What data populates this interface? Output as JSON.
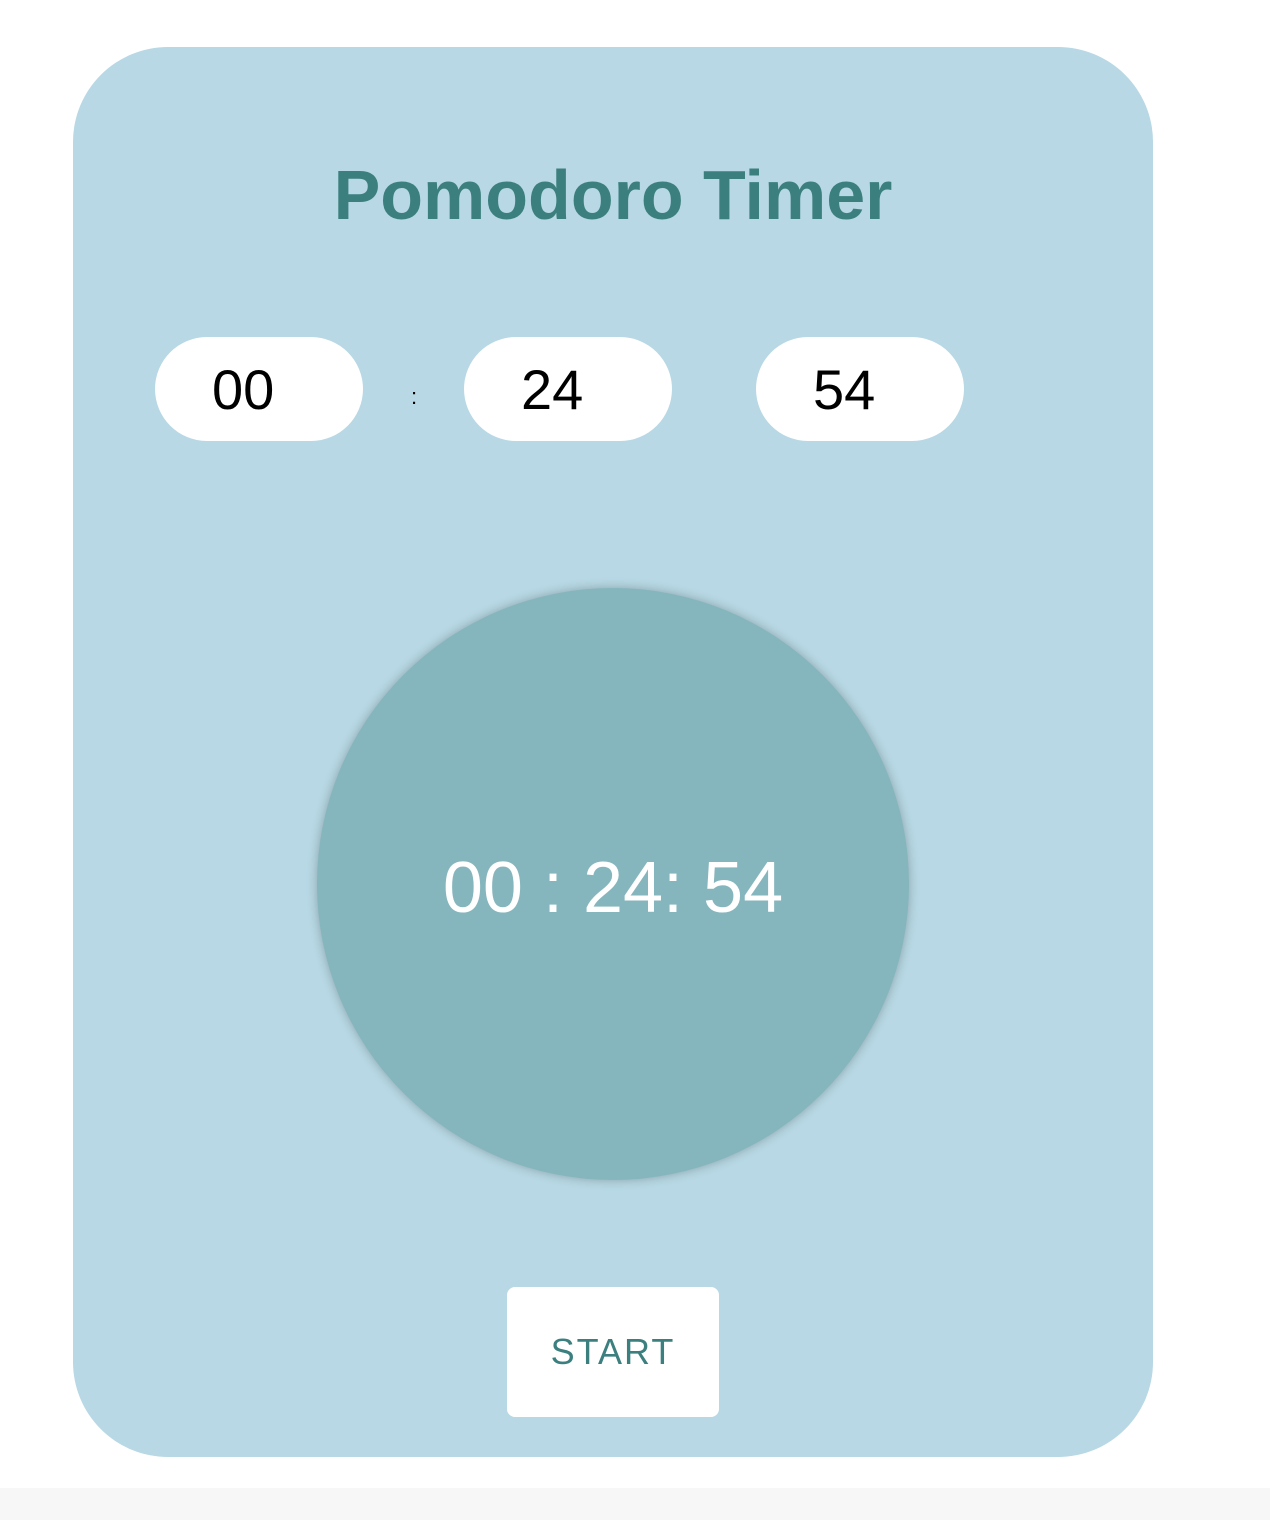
{
  "app": {
    "title": "Pomodoro Timer"
  },
  "inputs": {
    "hours": "00",
    "minutes": "24",
    "seconds": "54",
    "separator": ":"
  },
  "clock": {
    "display": "00 : 24: 54"
  },
  "controls": {
    "start_label": "START"
  },
  "colors": {
    "card_background": "#b7d8e4",
    "title_color": "#3c7f7f",
    "clock_circle": "#86b6bd",
    "clock_text": "#ffffff",
    "button_background": "#ffffff",
    "button_text": "#3c7f7f"
  }
}
